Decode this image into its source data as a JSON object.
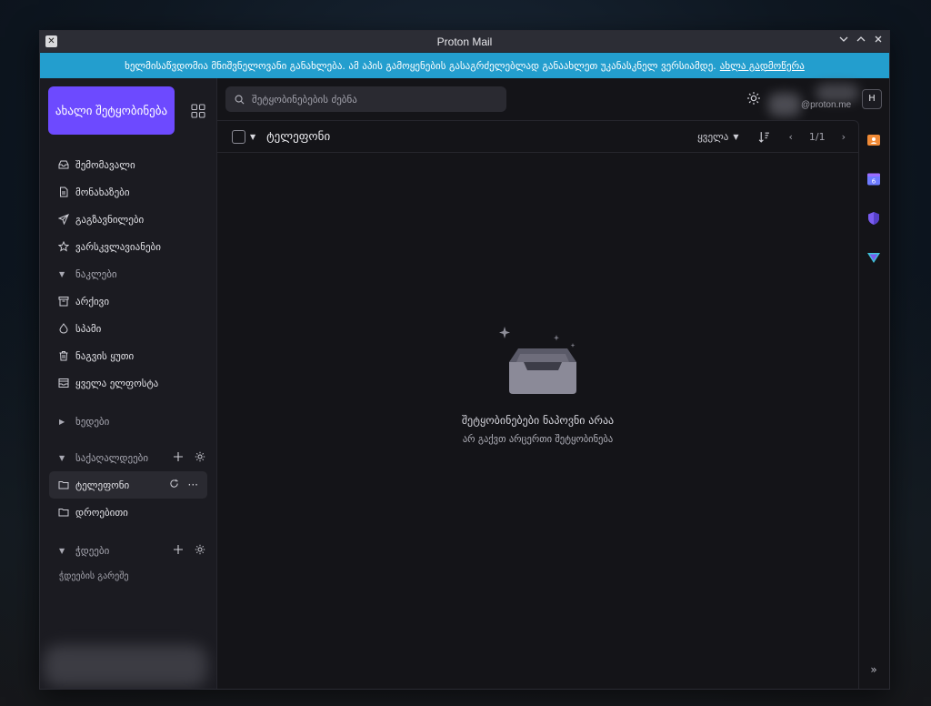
{
  "window": {
    "title": "Proton Mail"
  },
  "banner": {
    "text": "ხელმისაწვდომია მნიშვნელოვანი განახლება. ამ აპის გამოყენების გასაგრძელებლად განაახლეთ უკანასკნელ ვერსიამდე.",
    "link": "ახლა გადმოწერა"
  },
  "sidebar": {
    "compose_label": "ახალი შეტყობინება",
    "items": [
      {
        "label": "შემომავალი",
        "icon": "inbox-icon"
      },
      {
        "label": "მონახაზები",
        "icon": "drafts-icon"
      },
      {
        "label": "გაგზავნილები",
        "icon": "sent-icon"
      },
      {
        "label": "ვარსკვლავიანები",
        "icon": "star-icon"
      }
    ],
    "more_header": "ნაკლები",
    "more_items": [
      {
        "label": "არქივი",
        "icon": "archive-icon"
      },
      {
        "label": "სპამი",
        "icon": "spam-icon"
      },
      {
        "label": "ნაგვის ყუთი",
        "icon": "trash-icon"
      },
      {
        "label": "ყველა ელფოსტა",
        "icon": "all-mail-icon"
      }
    ],
    "views_header": "ხედები",
    "folders_header": "საქაღალდეები",
    "folders": [
      {
        "label": "ტელეფონი",
        "active": true
      },
      {
        "label": "დროებითი",
        "active": false
      }
    ],
    "labels_header": "ჭდეები",
    "labels_empty": "ჭდეების გარეშე"
  },
  "topbar": {
    "search_placeholder": "შეტყობინებების ძებნა",
    "email_suffix": "@proton.me",
    "avatar_letter": "H"
  },
  "list": {
    "folder_title": "ტელეფონი",
    "filter_label": "ყველა",
    "pagination": "1/1"
  },
  "empty_state": {
    "title": "შეტყობინებები ნაპოვნი არაა",
    "subtitle": "არ გაქვთ არცერთი შეტყობინება"
  },
  "colors": {
    "accent": "#6d4aff",
    "banner": "#239ece",
    "background": "#141418",
    "sidebar": "#1b1b21"
  }
}
